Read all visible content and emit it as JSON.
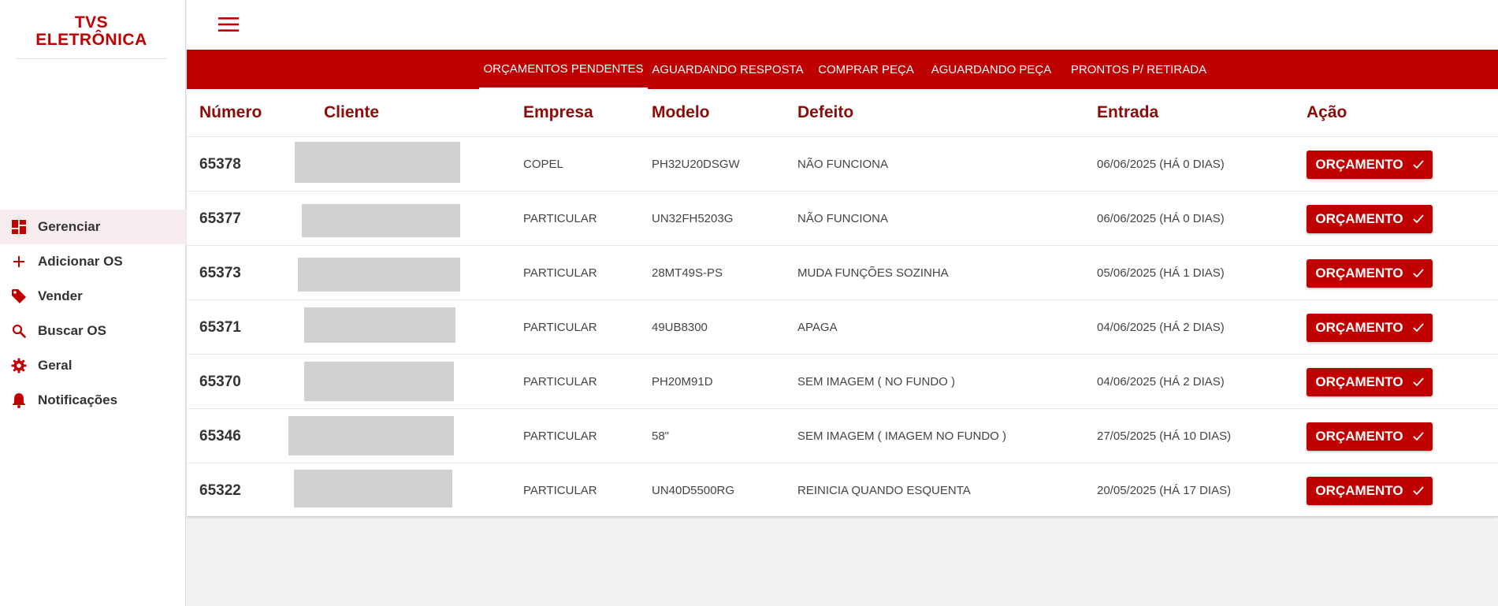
{
  "brand": {
    "line1": "TVS",
    "line2": "ELETRÔNICA"
  },
  "sidebar": {
    "items": [
      {
        "label": "Gerenciar",
        "icon": "dashboard-icon",
        "active": true
      },
      {
        "label": "Adicionar OS",
        "icon": "plus-icon"
      },
      {
        "label": "Vender",
        "icon": "tag-icon"
      },
      {
        "label": "Buscar OS",
        "icon": "search-icon"
      },
      {
        "label": "Geral",
        "icon": "gear-icon"
      },
      {
        "label": "Notificações",
        "icon": "bell-icon"
      }
    ]
  },
  "tabs": [
    {
      "label": "ORÇAMENTOS PENDENTES",
      "active": true
    },
    {
      "label": "AGUARDANDO RESPOSTA"
    },
    {
      "label": "COMPRAR PEÇA"
    },
    {
      "label": "AGUARDANDO PEÇA"
    },
    {
      "label": "PRONTOS P/ RETIRADA"
    }
  ],
  "table": {
    "headers": {
      "numero": "Número",
      "cliente": "Cliente",
      "empresa": "Empresa",
      "modelo": "Modelo",
      "defeito": "Defeito",
      "entrada": "Entrada",
      "acao": "Ação"
    },
    "action_label": "ORÇAMENTO",
    "rows": [
      {
        "numero": "65378",
        "empresa": "COPEL",
        "modelo": "PH32U20DSGW",
        "defeito": "NÃO FUNCIONA",
        "entrada": "06/06/2025 (HÁ 0 DIAS)"
      },
      {
        "numero": "65377",
        "empresa": "PARTICULAR",
        "modelo": "UN32FH5203G",
        "defeito": "NÃO FUNCIONA",
        "entrada": "06/06/2025 (HÁ 0 DIAS)"
      },
      {
        "numero": "65373",
        "empresa": "PARTICULAR",
        "modelo": "28MT49S-PS",
        "defeito": "MUDA FUNÇÕES SOZINHA",
        "entrada": "05/06/2025 (HÁ 1 DIAS)"
      },
      {
        "numero": "65371",
        "empresa": "PARTICULAR",
        "modelo": "49UB8300",
        "defeito": "APAGA",
        "entrada": "04/06/2025 (HÁ 2 DIAS)"
      },
      {
        "numero": "65370",
        "empresa": "PARTICULAR",
        "modelo": "PH20M91D",
        "defeito": "SEM IMAGEM ( NO FUNDO )",
        "entrada": "04/06/2025 (HÁ 2 DIAS)"
      },
      {
        "numero": "65346",
        "empresa": "PARTICULAR",
        "modelo": "58\"",
        "defeito": "SEM IMAGEM ( IMAGEM NO FUNDO )",
        "entrada": "27/05/2025 (HÁ 10 DIAS)"
      },
      {
        "numero": "65322",
        "empresa": "PARTICULAR",
        "modelo": "UN40D5500RG",
        "defeito": "REINICIA QUANDO ESQUENTA",
        "entrada": "20/05/2025 (HÁ 17 DIAS)"
      }
    ]
  },
  "colors": {
    "primary": "#c00000",
    "header_text": "#8c0a0a",
    "active_nav_bg": "#f7eced"
  }
}
